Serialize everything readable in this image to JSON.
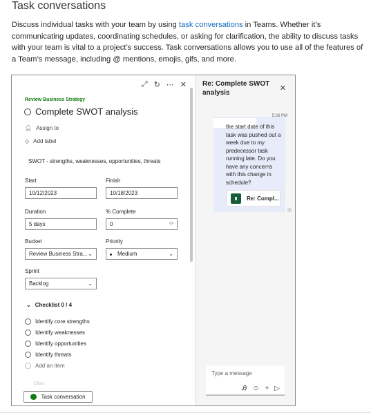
{
  "heading": "Task conversations",
  "intro": {
    "before": "Discuss individual tasks with your team by using ",
    "link": "task conversations",
    "after": " in Teams. Whether it’s communicating updates, coordinating schedules, or asking for clarification, the ability to discuss tasks with your team is vital to a project’s success. Task conversations allows you to use all of the features of a Team’s message, including @ mentions, emojis, gifs, and more."
  },
  "task": {
    "icons": [
      "expand-icon",
      "history-icon",
      "more-icon",
      "close-icon"
    ],
    "bucket_tag": "Review Business Strategy",
    "title": "Complete SWOT analysis",
    "assign": "Assign to",
    "label": "Add label",
    "description": "SWOT - strengths, weaknesses, opportunities, threats",
    "start_label": "Start",
    "start_value": "10/12/2023",
    "finish_label": "Finish",
    "finish_value": "10/18/2023",
    "duration_label": "Duration",
    "duration_value": "5 days",
    "complete_label": "% Complete",
    "complete_value": "0",
    "bucket_label": "Bucket",
    "bucket_value": "Review Business Stra...",
    "priority_label": "Priority",
    "priority_value": "Medium",
    "sprint_label": "Sprint",
    "sprint_value": "Backlog",
    "checklist_title": "Checklist 0 / 4",
    "checklist": [
      "Identify core strengths",
      "Identify weaknesses",
      "Identify opportunities",
      "Identify threats"
    ],
    "add_item": "Add an item",
    "effort": "Effort",
    "conversation_button": "Task conversation"
  },
  "chat": {
    "title": "Re: Complete SWOT analysis",
    "time": "5:26 PM",
    "message": "the start date of this task was pushed out a week due to my predecessor task running late. Do you have any concerns with this change in schedule?",
    "card_label": "Re: Compl...",
    "compose_placeholder": "Type a message"
  },
  "colors": {
    "link": "#0f6cbd",
    "bucket_tag": "#107c10",
    "bubble": "#e8ebfa",
    "card_icon": "#185c37"
  }
}
